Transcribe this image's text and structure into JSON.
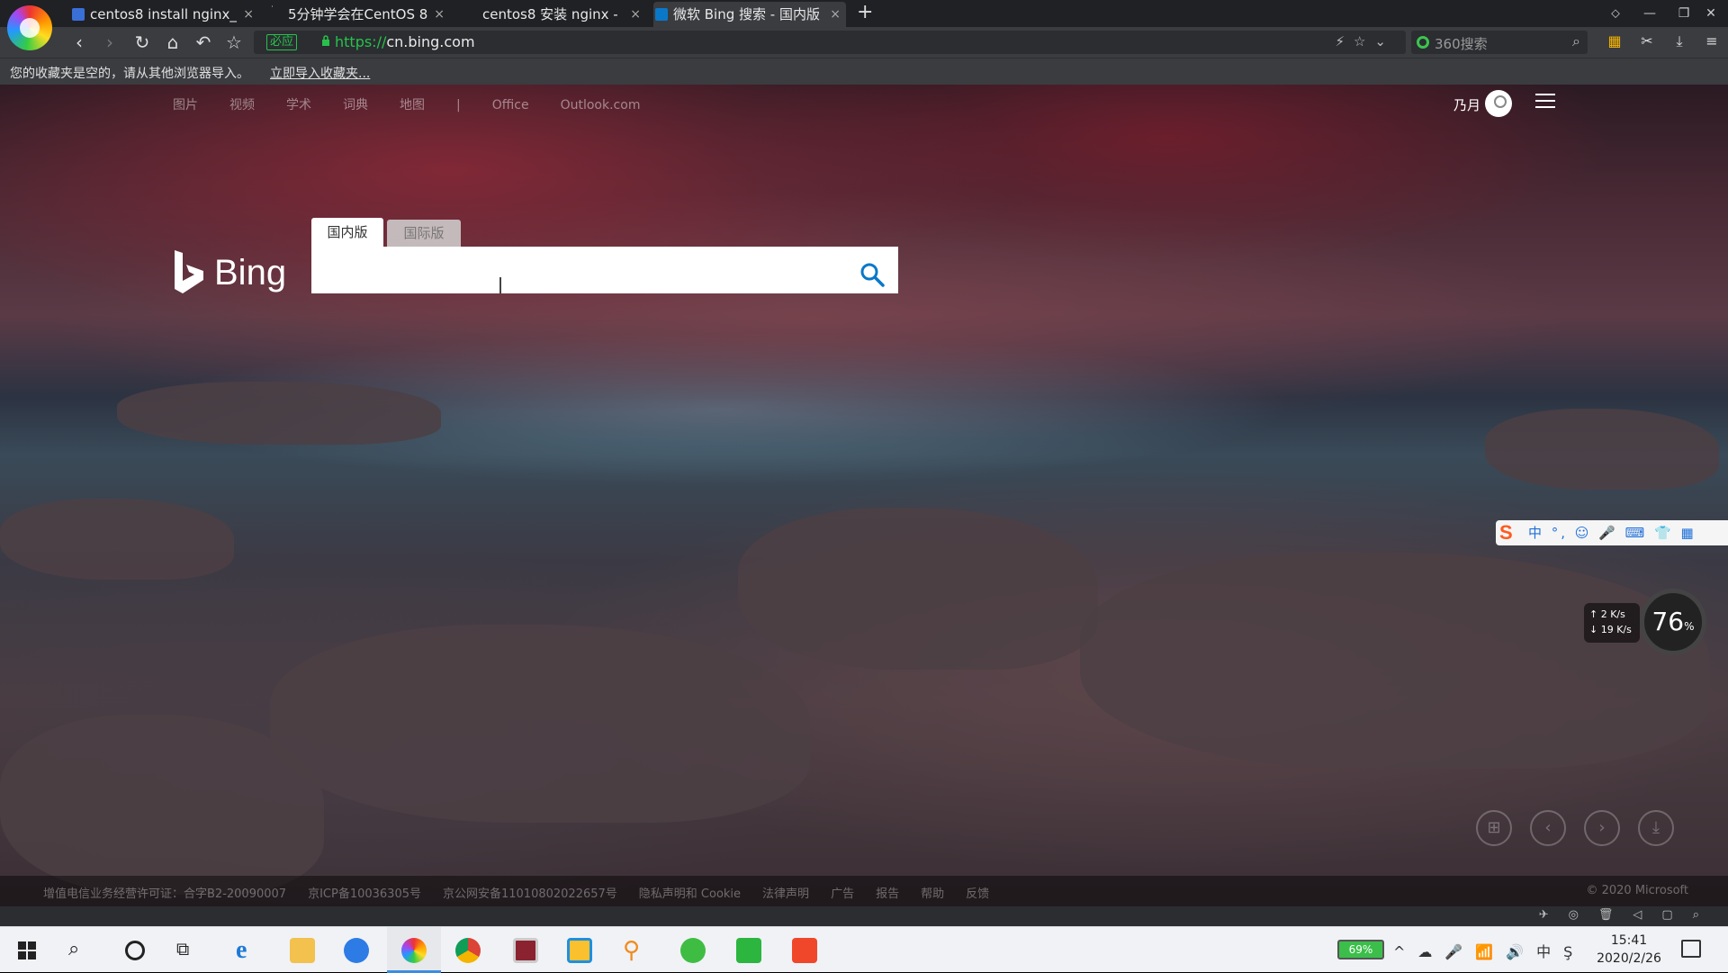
{
  "tabs": [
    {
      "title": "centos8 install nginx_",
      "close": "×"
    },
    {
      "title": "5分钟学会在CentOS 8",
      "close": "×"
    },
    {
      "title": "centos8 安装 nginx - ",
      "close": "×"
    },
    {
      "title": "微软 Bing 搜索 - 国内版",
      "close": "×"
    }
  ],
  "tab_add": "+",
  "address": {
    "cert_label": "必应",
    "url_proto": "https://",
    "url_host": "cn.bing.com",
    "search_placeholder": "360搜索"
  },
  "bookmarks": {
    "empty_text": "您的收藏夹是空的，请从其他浏览器导入。",
    "import_link": "立即导入收藏夹..."
  },
  "bing": {
    "nav": [
      "图片",
      "视频",
      "学术",
      "词典",
      "地图",
      "|",
      "Office",
      "Outlook.com"
    ],
    "user_name": "乃月",
    "logo_text": "Bing",
    "tab_domestic": "国内版",
    "tab_international": "国际版",
    "search_value": "",
    "footer_links": [
      "增值电信业务经营许可证：合字B2-20090007",
      "京ICP备10036305号",
      "京公网安备11010802022657号",
      "隐私声明和 Cookie",
      "法律声明",
      "广告",
      "报告",
      "帮助",
      "反馈"
    ],
    "copyright": "© 2020 Microsoft"
  },
  "widgets": {
    "ime_items": "中 °, ☺ 🎤 ⌨ 👕 ▦",
    "upload_speed": "↑ 2  K/s",
    "download_speed": "↓ 19  K/s",
    "cpu_percent": "76",
    "percent_sign": "%"
  },
  "taskbar": {
    "battery": "69%",
    "time": "15:41",
    "date": "2020/2/26"
  },
  "colors": {
    "accent_green": "#27c24c",
    "taskbar_active": "#3b8de0",
    "bing_blue": "#1e6fd9"
  }
}
